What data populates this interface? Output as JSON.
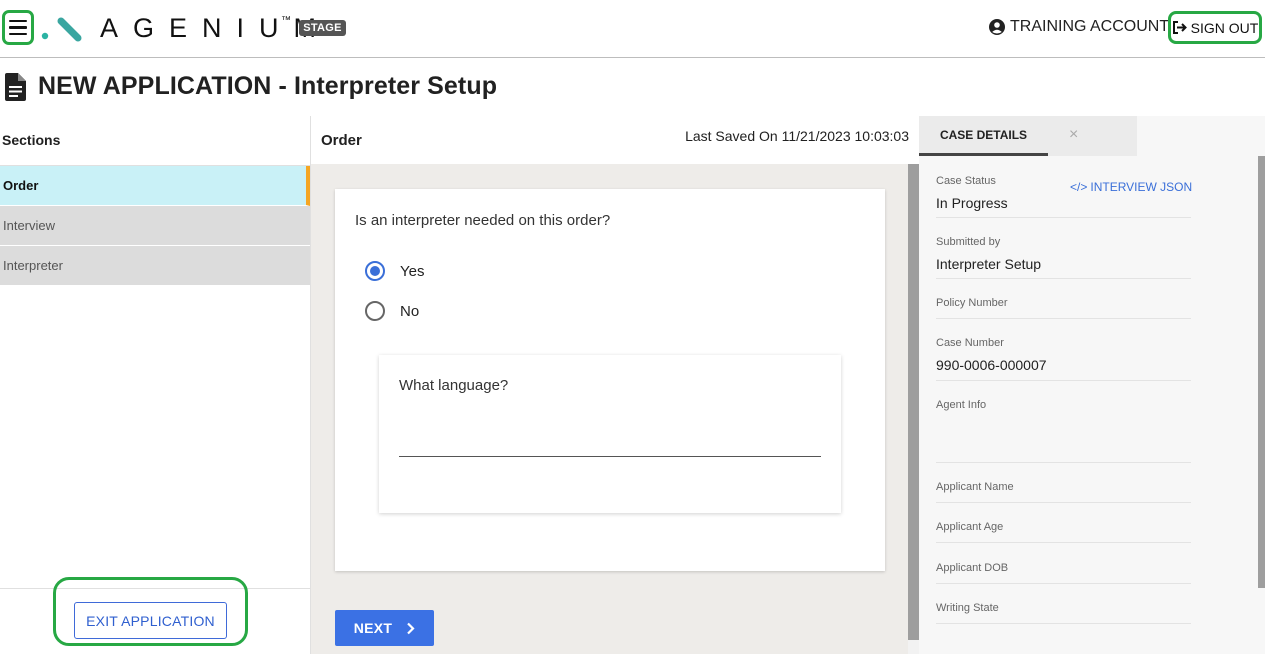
{
  "header": {
    "logo_text": "AGENIUM",
    "trademark": "™",
    "env_badge": "STAGE",
    "account_label": "TRAINING ACCOUNT",
    "signout_label": "SIGN OUT",
    "logo_colors": {
      "dot": "#2bb3a3",
      "slash": "#3aa6a0"
    }
  },
  "page": {
    "title": "NEW APPLICATION - Interpreter Setup"
  },
  "sidebar": {
    "header": "Sections",
    "items": [
      {
        "label": "Order",
        "active": true
      },
      {
        "label": "Interview",
        "active": false
      },
      {
        "label": "Interpreter",
        "active": false
      }
    ],
    "exit_label": "EXIT APPLICATION"
  },
  "main": {
    "section_title": "Order",
    "last_saved": "Last Saved On 11/21/2023 10:03:03",
    "question": "Is an interpreter needed on this order?",
    "options": [
      {
        "label": "Yes",
        "selected": true
      },
      {
        "label": "No",
        "selected": false
      }
    ],
    "language_label": "What language?",
    "language_value": "",
    "next_label": "NEXT"
  },
  "case_details": {
    "tab_label": "CASE DETAILS",
    "close_glyph": "×",
    "json_link": "INTERVIEW JSON",
    "fields": [
      {
        "label": "Case Status",
        "value": "In Progress"
      },
      {
        "label": "Submitted by",
        "value": "Interpreter Setup"
      },
      {
        "label": "Policy Number",
        "value": ""
      },
      {
        "label": "Case Number",
        "value": "990-0006-000007"
      },
      {
        "label": "Agent Info",
        "value": ""
      },
      {
        "label": "Applicant Name",
        "value": ""
      },
      {
        "label": "Applicant Age",
        "value": ""
      },
      {
        "label": "Applicant DOB",
        "value": ""
      },
      {
        "label": "Writing State",
        "value": ""
      }
    ]
  },
  "colors": {
    "accent_blue": "#3b71e4",
    "highlight_green": "#27a844",
    "active_section_bg": "#c9f1f7",
    "active_section_marker": "#f5a623"
  }
}
